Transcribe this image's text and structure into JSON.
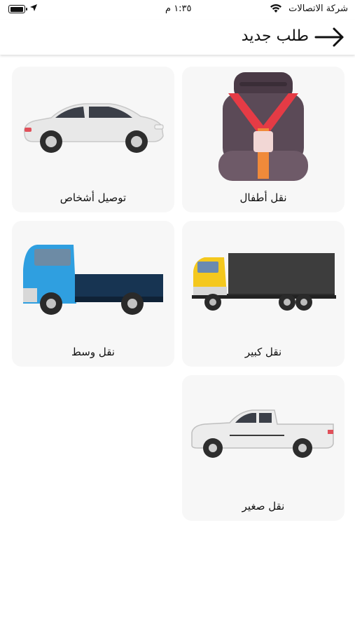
{
  "status_bar": {
    "carrier": "شركة الاتصالات",
    "time": "١:٣٥ م",
    "battery_level": 0.95
  },
  "header": {
    "title": "طلب جديد"
  },
  "categories": [
    {
      "label": "نقل أطفال",
      "icon": "child-car-seat-icon"
    },
    {
      "label": "توصيل أشخاص",
      "icon": "sedan-car-icon"
    },
    {
      "label": "نقل كبير",
      "icon": "large-truck-icon"
    },
    {
      "label": "نقل وسط",
      "icon": "medium-pickup-truck-icon"
    },
    {
      "label": "نقل صغير",
      "icon": "small-pickup-truck-icon"
    }
  ]
}
